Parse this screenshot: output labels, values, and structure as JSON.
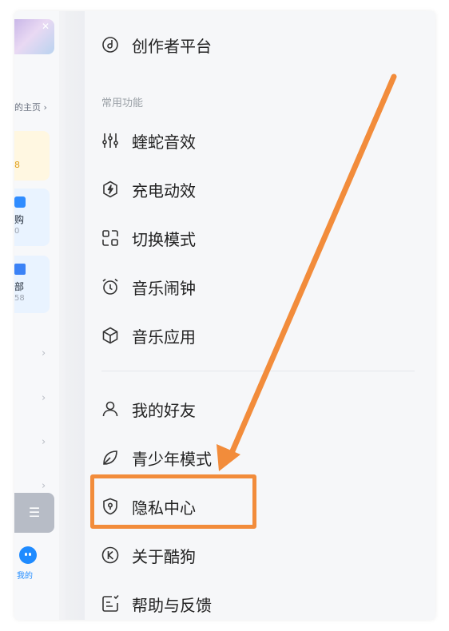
{
  "background": {
    "home_link": "的主页 ›",
    "card_yellow_value": "8",
    "card1": {
      "title": "购",
      "count": "0"
    },
    "card2": {
      "title": "部",
      "count": "58"
    },
    "mine_label": "我的"
  },
  "menu": {
    "creator_platform": "创作者平台",
    "section_common": "常用功能",
    "items_common": [
      {
        "label": "蝰蛇音效",
        "icon": "equalizer-icon"
      },
      {
        "label": "充电动效",
        "icon": "charging-icon"
      },
      {
        "label": "切换模式",
        "icon": "switch-mode-icon"
      },
      {
        "label": "音乐闹钟",
        "icon": "alarm-clock-icon"
      },
      {
        "label": "音乐应用",
        "icon": "cube-icon"
      }
    ],
    "items_other": [
      {
        "label": "我的好友",
        "icon": "person-icon"
      },
      {
        "label": "青少年模式",
        "icon": "leaf-icon"
      },
      {
        "label": "隐私中心",
        "icon": "privacy-shield-icon"
      },
      {
        "label": "关于酷狗",
        "icon": "kugou-logo-icon"
      },
      {
        "label": "帮助与反馈",
        "icon": "feedback-icon"
      }
    ]
  },
  "colors": {
    "annotation": "#f28c3b",
    "accent": "#1f8bff"
  }
}
